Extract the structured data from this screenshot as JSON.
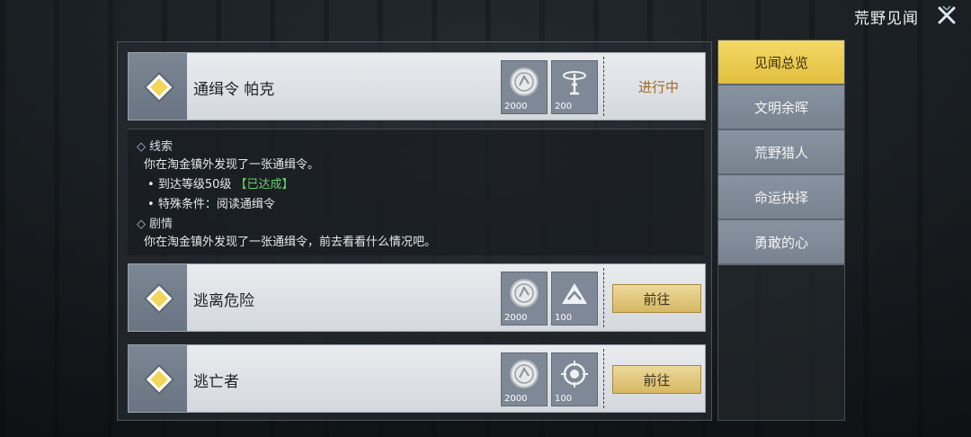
{
  "header": {
    "title": "荒野见闻"
  },
  "tabs": [
    {
      "label": "见闻总览",
      "active": true
    },
    {
      "label": "文明余晖",
      "active": false
    },
    {
      "label": "荒野猎人",
      "active": false
    },
    {
      "label": "命运抉择",
      "active": false
    },
    {
      "label": "勇敢的心",
      "active": false
    }
  ],
  "tasks": [
    {
      "title": "通缉令 帕克",
      "rewards": [
        {
          "icon": "silver-coin-icon",
          "amount": "2000"
        },
        {
          "icon": "radio-tower-icon",
          "amount": "200"
        }
      ],
      "status": "进行中"
    },
    {
      "title": "逃离危险",
      "rewards": [
        {
          "icon": "silver-coin-icon",
          "amount": "2000"
        },
        {
          "icon": "mountain-arrow-icon",
          "amount": "100"
        }
      ],
      "action": "前往"
    },
    {
      "title": "逃亡者",
      "rewards": [
        {
          "icon": "silver-coin-icon",
          "amount": "2000"
        },
        {
          "icon": "target-badge-icon",
          "amount": "100"
        }
      ],
      "action": "前往"
    }
  ],
  "details": {
    "clue_title": "线索",
    "clue_text": "你在淘金镇外发现了一张通缉令。",
    "req1": "到达等级50级",
    "req1_state": "【已达成】",
    "req2": "特殊条件：阅读通缉令",
    "story_title": "剧情",
    "story_text": "你在淘金镇外发现了一张通缉令，前去看看什么情况吧。"
  },
  "colors": {
    "accent_gold": "#e1bf3f",
    "status_orange": "#a06a24",
    "done_green": "#67d16b"
  }
}
